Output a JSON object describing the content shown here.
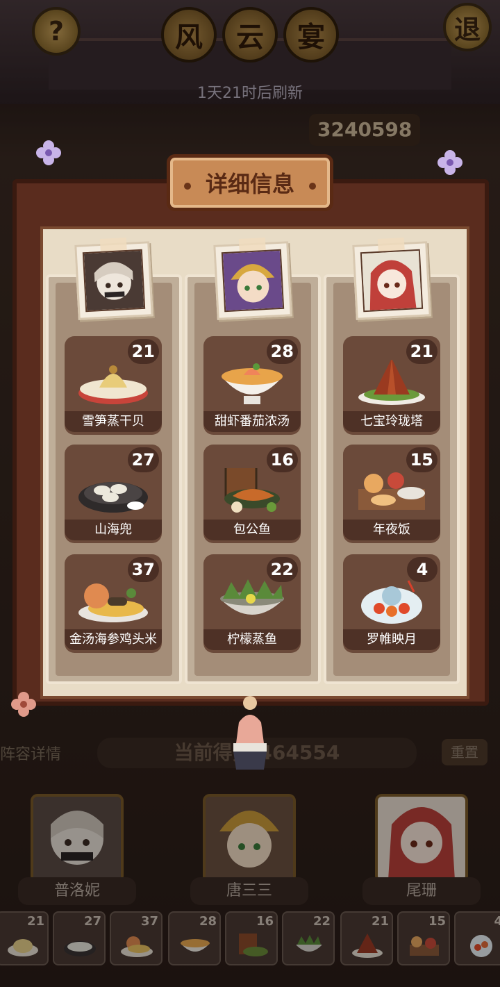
{
  "header": {
    "help_icon_glyph": "?",
    "exit_label": "退",
    "title_chars": [
      "风",
      "云",
      "宴"
    ],
    "refresh_text": "1天21时后刷新",
    "top_score": "3240598"
  },
  "panel": {
    "title": "详细信息",
    "columns": [
      {
        "chef": "普洛妮",
        "dishes": [
          {
            "name": "雪笋蒸干贝",
            "count": "21"
          },
          {
            "name": "山海兜",
            "count": "27"
          },
          {
            "name": "金汤海参鸡头米",
            "count": "37"
          }
        ]
      },
      {
        "chef": "唐三三",
        "dishes": [
          {
            "name": "甜虾番茄浓汤",
            "count": "28"
          },
          {
            "name": "包公鱼",
            "count": "16"
          },
          {
            "name": "柠檬蒸鱼",
            "count": "22"
          }
        ]
      },
      {
        "chef": "尾珊",
        "dishes": [
          {
            "name": "七宝玲珑塔",
            "count": "21"
          },
          {
            "name": "年夜饭",
            "count": "15"
          },
          {
            "name": "罗帷映月",
            "count": "4"
          }
        ]
      }
    ]
  },
  "footer": {
    "lineup_label": "阵容详情",
    "current_score_label": "当前得分",
    "current_score": "464554",
    "reset_label": "重置",
    "chefs": [
      "普洛妮",
      "唐三三",
      "尾珊"
    ],
    "dish_counts": [
      "21",
      "27",
      "37",
      "28",
      "16",
      "22",
      "21",
      "15",
      "4"
    ]
  },
  "colors": {
    "board": "#5a2c1e",
    "paper": "#e8dcc6",
    "dish_tile": "#6b4a3a",
    "plaque": "#c88a56"
  }
}
